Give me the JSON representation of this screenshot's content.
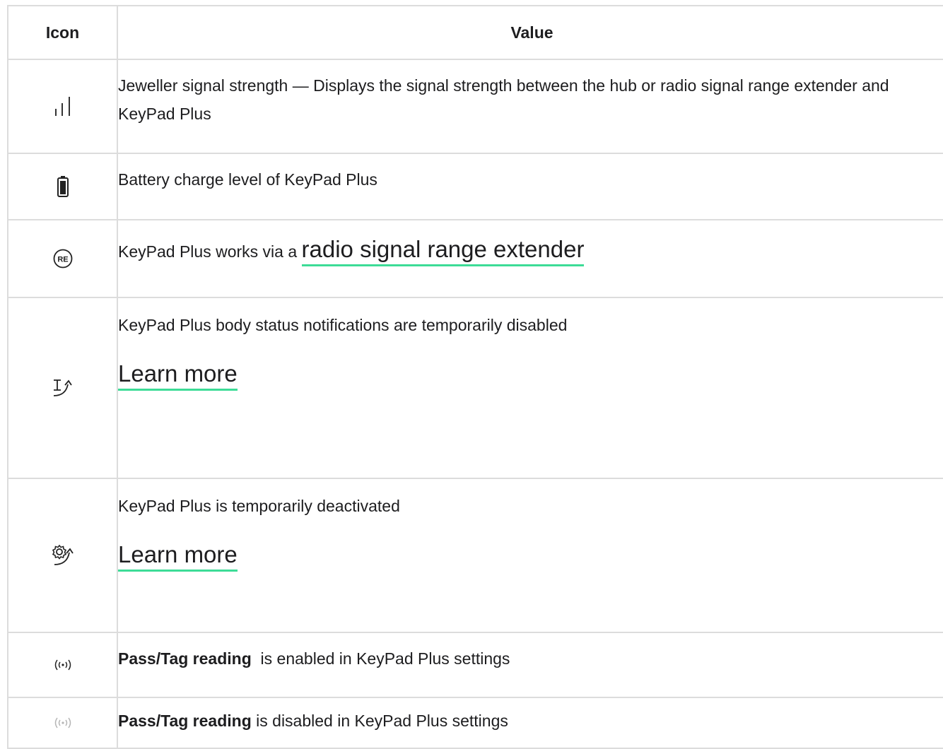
{
  "headers": {
    "icon": "Icon",
    "value": "Value"
  },
  "rows": [
    {
      "icon": "signal-strength-icon",
      "text": "Jeweller signal strength — Displays the signal strength between the hub or radio signal range extender and KeyPad Plus"
    },
    {
      "icon": "battery-icon",
      "text": "Battery charge level of KeyPad Plus"
    },
    {
      "icon": "range-extender-icon",
      "text": "KeyPad Plus works via a ",
      "link": "radio signal range extender"
    },
    {
      "icon": "body-status-disabled-icon",
      "text": "KeyPad Plus body status notifications are temporarily disabled",
      "link": "Learn more"
    },
    {
      "icon": "deactivated-gear-icon",
      "text": "KeyPad Plus is temporarily deactivated",
      "link": "Learn more"
    },
    {
      "icon": "pass-tag-enabled-icon",
      "bold": "Pass/Tag reading",
      "text": "  is enabled in KeyPad Plus settings"
    },
    {
      "icon": "pass-tag-disabled-icon",
      "bold": "Pass/Tag reading",
      "text": " is disabled in KeyPad Plus settings"
    }
  ],
  "colors": {
    "link_underline": "#3ddc97",
    "border": "#dcdcdc",
    "text": "#1d1d1f",
    "disabled_icon": "#b5b5b5"
  }
}
